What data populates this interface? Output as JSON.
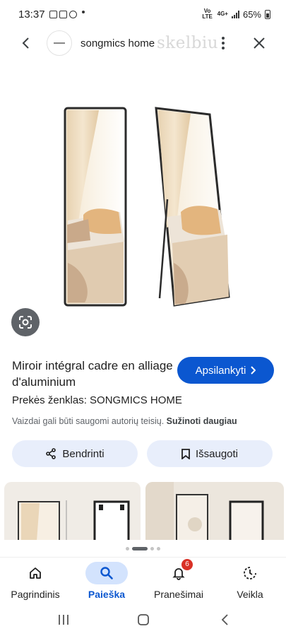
{
  "status": {
    "time": "13:37",
    "network": "Vo LTE",
    "net_type": "4G+",
    "battery": "65%"
  },
  "header": {
    "site_name": "songmics home",
    "watermark": "skelbiu"
  },
  "product": {
    "title": "Miroir intégral cadre en alliage d'aluminium",
    "visit_label": "Apsilankyti",
    "brand_line": "Prekės ženklas: SONGMICS HOME",
    "copyright_text": "Vaizdai gali būti saugomi autorių teisių.",
    "learn_more": "Sužinoti daugiau"
  },
  "actions": {
    "share_label": "Bendrinti",
    "save_label": "Išsaugoti"
  },
  "bottom_nav": {
    "items": [
      {
        "label": "Pagrindinis",
        "icon": "home-icon"
      },
      {
        "label": "Paieška",
        "icon": "search-icon"
      },
      {
        "label": "Pranešimai",
        "icon": "bell-icon",
        "badge": "6"
      },
      {
        "label": "Veikla",
        "icon": "activity-icon"
      }
    ]
  },
  "colors": {
    "accent": "#0b57d0",
    "chip_bg": "#e8eefb",
    "nav_active_bg": "#d3e3fd",
    "badge": "#d93025"
  }
}
